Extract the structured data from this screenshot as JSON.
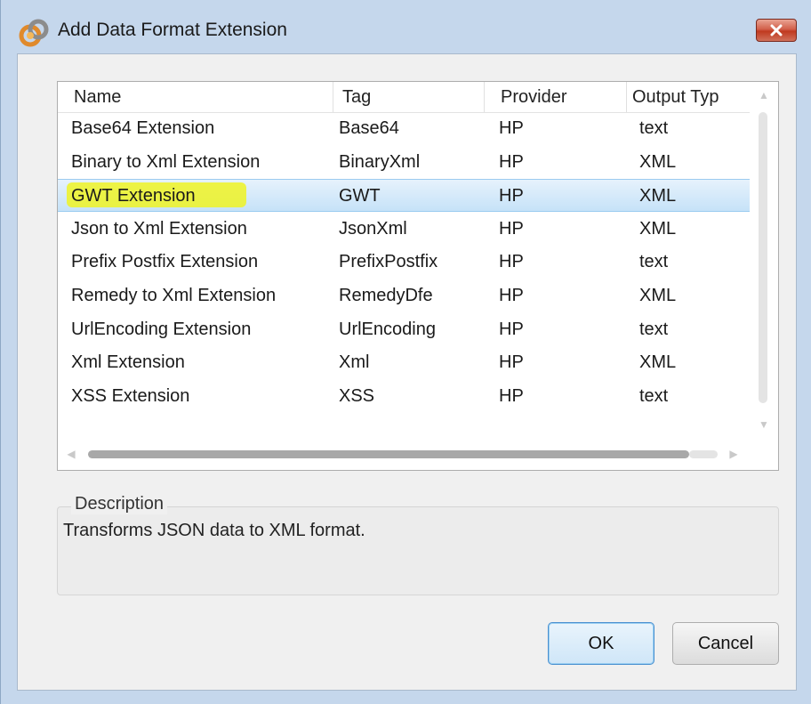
{
  "window": {
    "title": "Add Data Format Extension",
    "close_label": "×"
  },
  "table": {
    "columns": [
      "Name",
      "Tag",
      "Provider",
      "Output Typ"
    ],
    "rows": [
      {
        "name": "Base64 Extension",
        "tag": "Base64",
        "provider": "HP",
        "output": "text"
      },
      {
        "name": "Binary to Xml Extension",
        "tag": "BinaryXml",
        "provider": "HP",
        "output": "XML"
      },
      {
        "name": "GWT Extension",
        "tag": "GWT",
        "provider": "HP",
        "output": "XML"
      },
      {
        "name": "Json to Xml Extension",
        "tag": "JsonXml",
        "provider": "HP",
        "output": "XML"
      },
      {
        "name": "Prefix Postfix Extension",
        "tag": "PrefixPostfix",
        "provider": "HP",
        "output": "text"
      },
      {
        "name": "Remedy to Xml Extension",
        "tag": "RemedyDfe",
        "provider": "HP",
        "output": "XML"
      },
      {
        "name": "UrlEncoding Extension",
        "tag": "UrlEncoding",
        "provider": "HP",
        "output": "text"
      },
      {
        "name": "Xml Extension",
        "tag": "Xml",
        "provider": "HP",
        "output": "XML"
      },
      {
        "name": "XSS Extension",
        "tag": "XSS",
        "provider": "HP",
        "output": "text"
      }
    ],
    "selected_row": "GWT Extension"
  },
  "description": {
    "legend": "Description",
    "text": "Transforms JSON data to XML format."
  },
  "buttons": {
    "ok": "OK",
    "cancel": "Cancel"
  },
  "colors": {
    "selection": "#c6e2f8",
    "highlighter": "#eef325",
    "close_button": "#c0391f"
  }
}
